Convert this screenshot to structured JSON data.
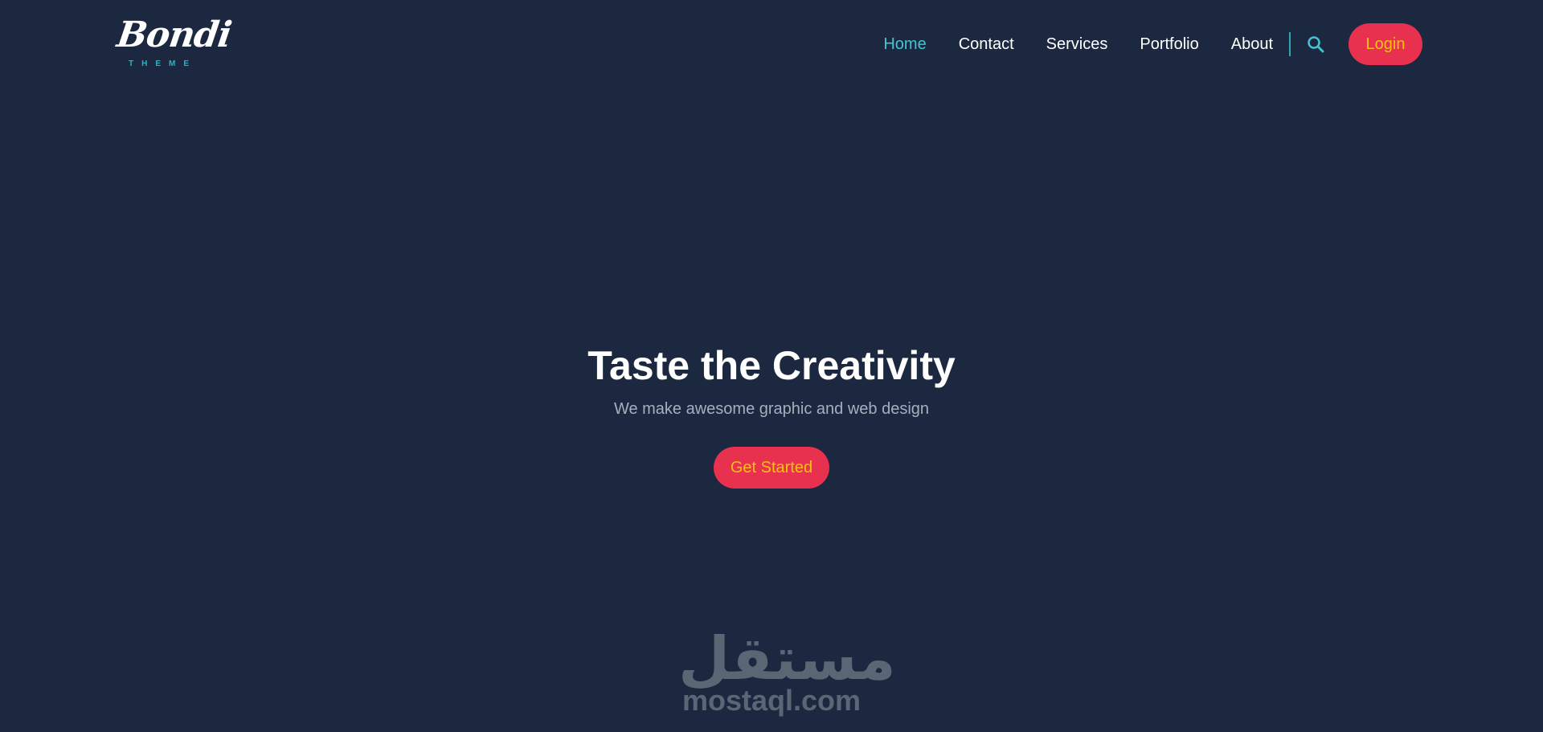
{
  "header": {
    "logo": {
      "word": "Bondi",
      "sub": "THEME"
    },
    "nav": {
      "items": [
        {
          "label": "Home",
          "active": true
        },
        {
          "label": "Contact",
          "active": false
        },
        {
          "label": "Services",
          "active": false
        },
        {
          "label": "Portfolio",
          "active": false
        },
        {
          "label": "About",
          "active": false
        }
      ],
      "search_icon": "search-icon",
      "login_label": "Login"
    }
  },
  "hero": {
    "title": "Taste the Creativity",
    "subtitle": "We make awesome graphic and web design",
    "cta_label": "Get Started"
  },
  "watermark": {
    "arabic": "مستقل",
    "domain": "mostaql.com"
  },
  "colors": {
    "background": "#1b2840",
    "accent": "#3fc6d2",
    "button_bg": "#e8304f",
    "button_text": "#f3c20f",
    "muted_text": "#a7afbd"
  }
}
